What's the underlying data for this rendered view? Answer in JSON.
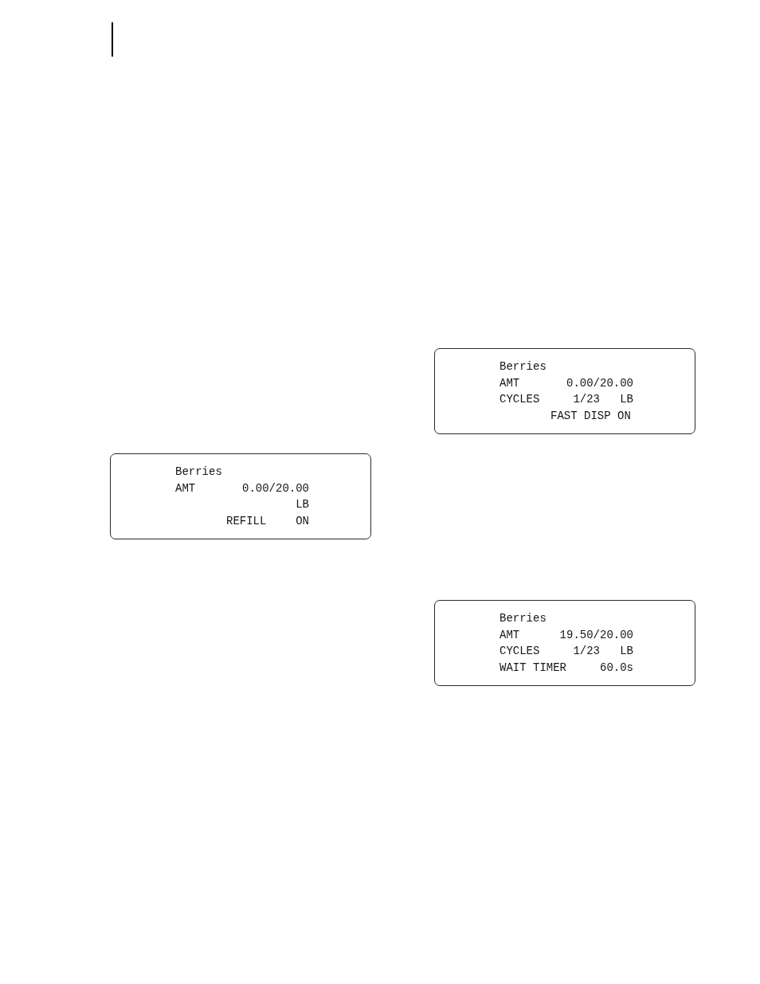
{
  "left_column": {
    "displays": [
      {
        "lines": [
          [
            {
              "kind": "title",
              "text": "Berries"
            }
          ],
          [
            {
              "kind": "label",
              "text": "AMT"
            },
            {
              "kind": "amount",
              "text": "0.00/20.00"
            }
          ],
          [
            {
              "kind": "unit",
              "text": "LB"
            }
          ],
          [
            {
              "kind": "option",
              "text": "REFILL"
            },
            {
              "kind": "state",
              "text": "ON"
            }
          ]
        ]
      }
    ]
  },
  "right_column": {
    "displays": [
      {
        "lines": [
          [
            {
              "kind": "title",
              "text": "Berries"
            }
          ],
          [
            {
              "kind": "label",
              "text": "AMT"
            },
            {
              "kind": "amount",
              "text": "0.00/20.00"
            }
          ],
          [
            {
              "kind": "label",
              "text": "CYCLES"
            },
            {
              "kind": "count",
              "text": "1/23"
            },
            {
              "kind": "unit",
              "text": "LB"
            }
          ],
          [
            {
              "kind": "notice",
              "text": "FAST DISP ON"
            }
          ]
        ]
      },
      {
        "lines": [
          [
            {
              "kind": "title",
              "text": "Berries"
            }
          ],
          [
            {
              "kind": "label",
              "text": "AMT"
            },
            {
              "kind": "amount",
              "text": "19.50/20.00"
            }
          ],
          [
            {
              "kind": "label",
              "text": "CYCLES"
            },
            {
              "kind": "count",
              "text": "1/23"
            },
            {
              "kind": "unit",
              "text": "LB"
            }
          ],
          [
            {
              "kind": "label",
              "text": "WAIT TIMER"
            },
            {
              "kind": "state",
              "text": "60.0s"
            }
          ]
        ]
      }
    ]
  }
}
